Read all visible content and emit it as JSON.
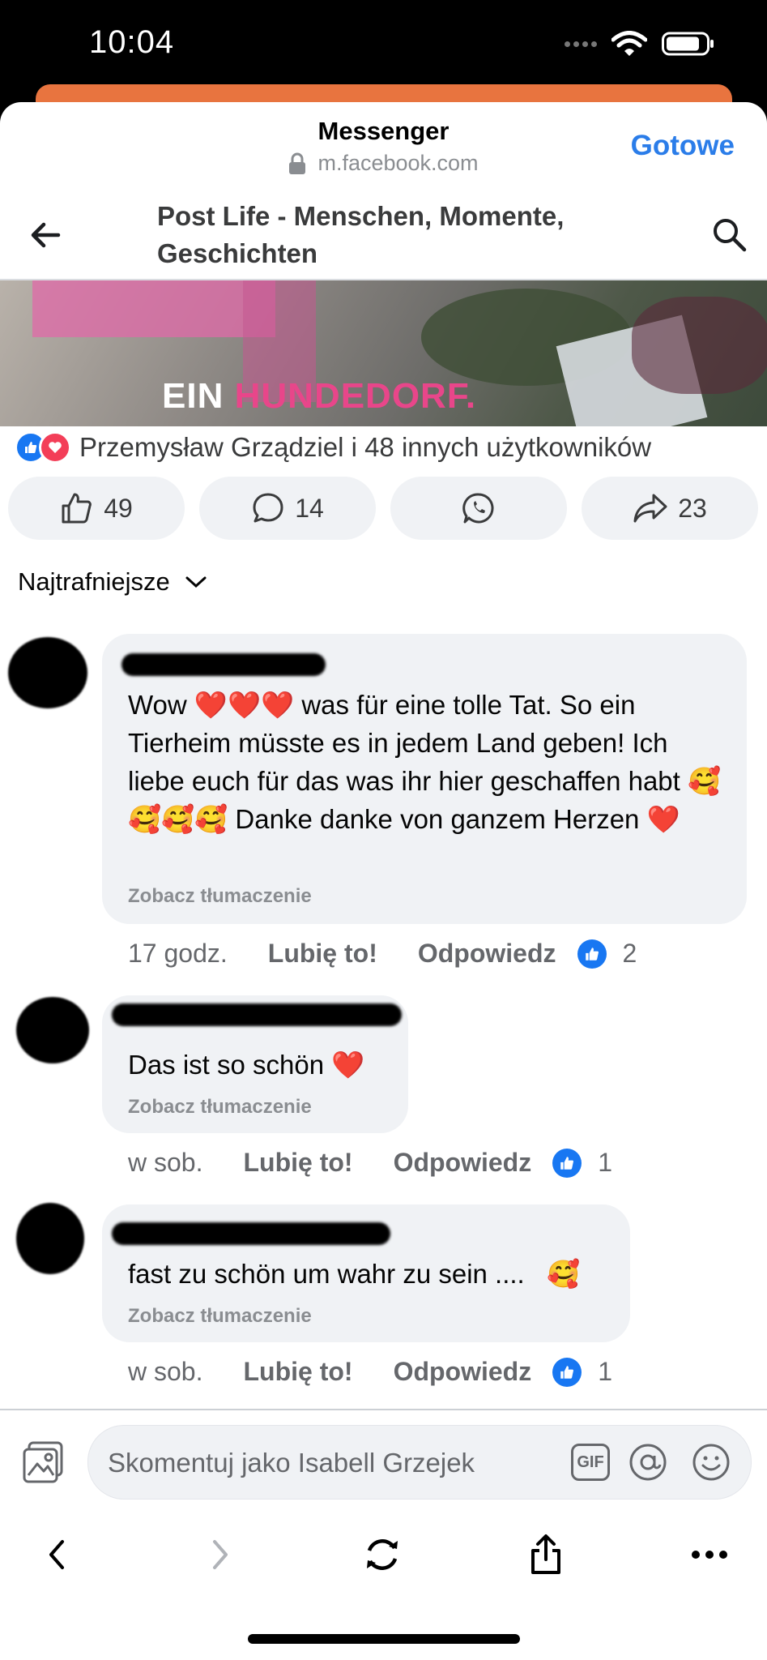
{
  "status": {
    "time": "10:04"
  },
  "browser": {
    "title": "Messenger",
    "url": "m.facebook.com",
    "done_label": "Gotowe"
  },
  "post": {
    "title": "Post Life - Menschen, Momente, Geschichten",
    "video_caption_word1": "EIN",
    "video_caption_word2": "HUNDEDORF.",
    "reactions_text": "Przemysław Grządziel i 48 innych użytkowników",
    "likes_count": "49",
    "comments_count": "14",
    "shares_count": "23",
    "sort_label": "Najtrafniejsze"
  },
  "comments": [
    {
      "text": "Wow ❤️❤️❤️ was für eine tolle Tat. So ein Tierheim müsste es in jedem Land geben! Ich liebe euch für das was ihr hier geschaffen habt 🥰🥰🥰🥰 Danke danke von ganzem Herzen ❤️",
      "translate": "Zobacz tłumaczenie",
      "time": "17 godz.",
      "like": "Lubię to!",
      "reply": "Odpowiedz",
      "reaction_count": "2"
    },
    {
      "text": "Das ist so schön ❤️",
      "translate": "Zobacz tłumaczenie",
      "time": "w sob.",
      "like": "Lubię to!",
      "reply": "Odpowiedz",
      "reaction_count": "1"
    },
    {
      "text": "fast zu schön um wahr zu sein ....   🥰",
      "translate": "Zobacz tłumaczenie",
      "time": "w sob.",
      "like": "Lubię to!",
      "reply": "Odpowiedz",
      "reaction_count": "1"
    }
  ],
  "composer": {
    "placeholder": "Skomentuj jako Isabell Grzejek",
    "gif_label": "GIF"
  },
  "colors": {
    "accent": "#1877f2",
    "done": "#2b7de9",
    "orange": "#e8743f",
    "caption_pink": "#e8468a"
  }
}
